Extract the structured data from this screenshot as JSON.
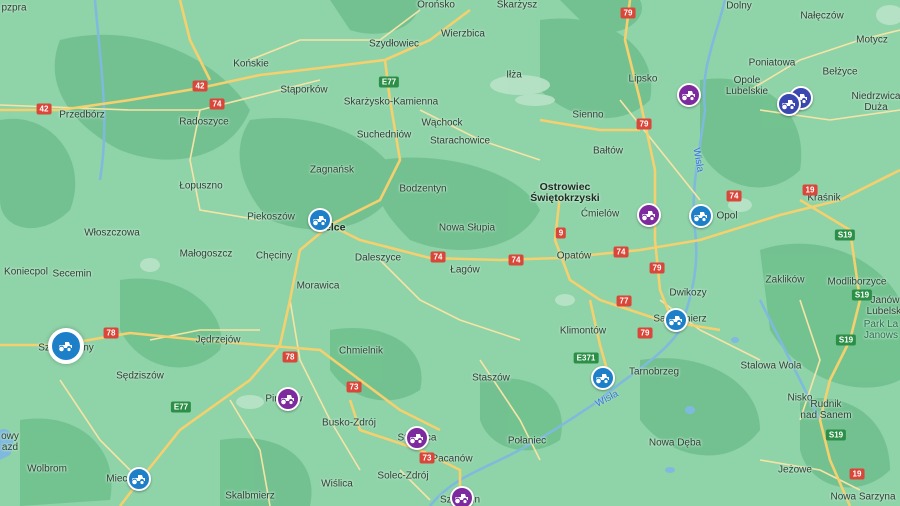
{
  "places": [
    {
      "id": "orzna",
      "text": "Orońsko"
    },
    {
      "id": "skarzysz",
      "text": "Skarżysz"
    },
    {
      "id": "dolny",
      "text": "Dolny"
    },
    {
      "id": "naleczow",
      "text": "Nałęczów"
    },
    {
      "id": "przedborz_top",
      "text": "pzpra"
    },
    {
      "id": "szydlowiec",
      "text": "Szydłowiec"
    },
    {
      "id": "wierzbica",
      "text": "Wierzbica"
    },
    {
      "id": "motycz",
      "text": "Motycz"
    },
    {
      "id": "konskie",
      "text": "Końskie"
    },
    {
      "id": "ilza",
      "text": "Iłża"
    },
    {
      "id": "lipsko",
      "text": "Lipsko"
    },
    {
      "id": "opole",
      "text": "Opole\nLubelskie"
    },
    {
      "id": "poniatowa",
      "text": "Poniatowa"
    },
    {
      "id": "belzyce",
      "text": "Bełżyce"
    },
    {
      "id": "przedborz",
      "text": "Przedbórz"
    },
    {
      "id": "staporkow",
      "text": "Stąporków"
    },
    {
      "id": "skarzysko",
      "text": "Skarżysko-Kamienna"
    },
    {
      "id": "niedrzwica",
      "text": "Niedrzwica\nDuża"
    },
    {
      "id": "radoszyce",
      "text": "Radoszyce"
    },
    {
      "id": "wachock",
      "text": "Wąchock"
    },
    {
      "id": "sienno",
      "text": "Sienno"
    },
    {
      "id": "suchedniow",
      "text": "Suchedniów"
    },
    {
      "id": "starachowice",
      "text": "Starachowice"
    },
    {
      "id": "baltow",
      "text": "Bałtów"
    },
    {
      "id": "zagnansk",
      "text": "Zagnańsk"
    },
    {
      "id": "lopuszno",
      "text": "Łopuszno"
    },
    {
      "id": "bodzentyn",
      "text": "Bodzentyn"
    },
    {
      "id": "ostrowiec",
      "text": "Ostrowiec\nŚwiętokrzyski"
    },
    {
      "id": "krasnik",
      "text": "Kraśnik"
    },
    {
      "id": "piekoszow",
      "text": "Piekoszów"
    },
    {
      "id": "kielce",
      "text": "Kielce"
    },
    {
      "id": "cmielow",
      "text": "Ćmielów"
    },
    {
      "id": "opol",
      "text": "Opol"
    },
    {
      "id": "wloszczowa",
      "text": "Włoszczowa"
    },
    {
      "id": "malogoszcz",
      "text": "Małogoszcz"
    },
    {
      "id": "nowa_slupia",
      "text": "Nowa Słupia"
    },
    {
      "id": "checiny",
      "text": "Chęciny"
    },
    {
      "id": "daleszyce",
      "text": "Daleszyce"
    },
    {
      "id": "opatow",
      "text": "Opatów"
    },
    {
      "id": "koniecpol",
      "text": "Koniecpol"
    },
    {
      "id": "secemin",
      "text": "Secemin"
    },
    {
      "id": "lagow",
      "text": "Łagów"
    },
    {
      "id": "zaklikow",
      "text": "Zaklików"
    },
    {
      "id": "modliborzyce",
      "text": "Modliborzyce"
    },
    {
      "id": "morawica",
      "text": "Morawica"
    },
    {
      "id": "dwikozy",
      "text": "Dwikozy"
    },
    {
      "id": "janow",
      "text": "Janów\nLubelski"
    },
    {
      "id": "sandomierz",
      "text": "Sandomierz"
    },
    {
      "id": "szczekociny",
      "text": "Szczekociny"
    },
    {
      "id": "jedrzejow",
      "text": "Jędrzejów"
    },
    {
      "id": "klimontow",
      "text": "Klimontów"
    },
    {
      "id": "chmielnik",
      "text": "Chmielnik"
    },
    {
      "id": "sedziszow",
      "text": "Sędziszów"
    },
    {
      "id": "tarnobrzeg",
      "text": "Tarnobrzeg"
    },
    {
      "id": "staszow",
      "text": "Staszów"
    },
    {
      "id": "stalowa",
      "text": "Stalowa Wola"
    },
    {
      "id": "pinczow",
      "text": "Pińczów"
    },
    {
      "id": "nisko",
      "text": "Nisko"
    },
    {
      "id": "busko",
      "text": "Busko-Zdrój"
    },
    {
      "id": "polaniec",
      "text": "Połaniec"
    },
    {
      "id": "nowa_deba",
      "text": "Nowa Dęba"
    },
    {
      "id": "stopnica",
      "text": "Stopnica"
    },
    {
      "id": "rudnik",
      "text": "Rudnik\nnad Sanem"
    },
    {
      "id": "pacanow",
      "text": "Pacanów"
    },
    {
      "id": "wolbrom",
      "text": "Wolbrom"
    },
    {
      "id": "solec",
      "text": "Solec-Zdrój"
    },
    {
      "id": "jezowe",
      "text": "Jeżowe"
    },
    {
      "id": "miechow",
      "text": "Miechów"
    },
    {
      "id": "wislica",
      "text": "Wiślica"
    },
    {
      "id": "skalbmierz",
      "text": "Skalbmierz"
    },
    {
      "id": "nowa_sarzyna",
      "text": "Nowa Sarzyna"
    },
    {
      "id": "szczucin",
      "text": "Szczucin"
    },
    {
      "id": "park",
      "text": "Park La\nJanows"
    },
    {
      "id": "owy",
      "text": "owy\nazd"
    }
  ],
  "rivers": [
    {
      "id": "wisla_south",
      "text": "Wisła"
    },
    {
      "id": "wisla_north",
      "text": "Wisła"
    }
  ],
  "shields": [
    {
      "id": "r79_top",
      "text": "79"
    },
    {
      "id": "r42_left",
      "text": "42"
    },
    {
      "id": "r42_top",
      "text": "42"
    },
    {
      "id": "e77_top",
      "text": "E77"
    },
    {
      "id": "r74_konskie",
      "text": "74"
    },
    {
      "id": "r79_lipsko",
      "text": "79"
    },
    {
      "id": "r9",
      "text": "9"
    },
    {
      "id": "r74_lagow",
      "text": "74"
    },
    {
      "id": "r74_opatow",
      "text": "74"
    },
    {
      "id": "r74_east",
      "text": "74"
    },
    {
      "id": "r79_dwik",
      "text": "79"
    },
    {
      "id": "r78_left",
      "text": "78"
    },
    {
      "id": "r78_mid",
      "text": "78"
    },
    {
      "id": "r77",
      "text": "77"
    },
    {
      "id": "r79_sand",
      "text": "79"
    },
    {
      "id": "e371",
      "text": "E371"
    },
    {
      "id": "r73_busko",
      "text": "73"
    },
    {
      "id": "e77_bottom",
      "text": "E77"
    },
    {
      "id": "r73_pacanow",
      "text": "73"
    },
    {
      "id": "r74_far",
      "text": "74"
    },
    {
      "id": "r19_mid",
      "text": "19"
    },
    {
      "id": "s19_a",
      "text": "S19"
    },
    {
      "id": "s19_b",
      "text": "S19"
    },
    {
      "id": "s19_c",
      "text": "S19"
    },
    {
      "id": "s19_d",
      "text": "S19"
    },
    {
      "id": "r19_low",
      "text": "19"
    }
  ],
  "markers": {
    "blue_label": "service-location",
    "purple_label": "dealer-location",
    "navy_label": "cluster-location"
  },
  "colors": {
    "land": "#8fd3a8",
    "forest": "#6fbf8d",
    "road": "#f4d06f",
    "highway": "#f7c84a",
    "water": "#7fb9de",
    "marker_blue": "#1e7fc9",
    "marker_purple": "#7d2a9e",
    "marker_navy": "#3a48b0"
  }
}
